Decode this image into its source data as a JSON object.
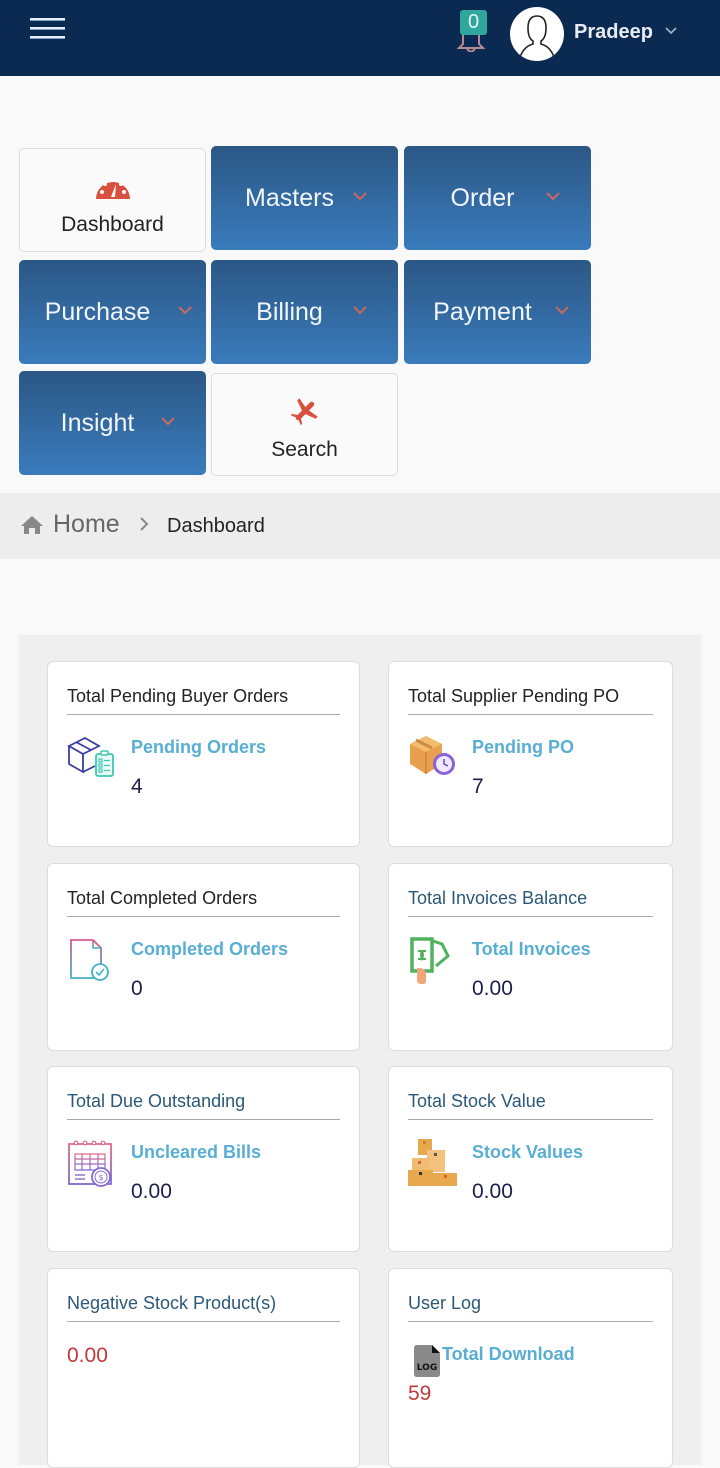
{
  "header": {
    "notification_count": "0",
    "user_name": "Pradeep"
  },
  "menu": {
    "dashboard": "Dashboard",
    "masters": "Masters",
    "order": "Order",
    "purchase": "Purchase",
    "billing": "Billing",
    "payment": "Payment",
    "insight": "Insight",
    "search": "Search"
  },
  "breadcrumb": {
    "home": "Home",
    "current": "Dashboard"
  },
  "cards": [
    {
      "title": "Total Pending Buyer Orders",
      "label": "Pending Orders",
      "value": "4"
    },
    {
      "title": "Total Supplier Pending PO",
      "label": "Pending PO",
      "value": "7"
    },
    {
      "title": "Total Completed Orders",
      "label": "Completed Orders",
      "value": "0"
    },
    {
      "title": "Total Invoices Balance",
      "label": "Total Invoices",
      "value": "0.00"
    },
    {
      "title": "Total Due Outstanding",
      "label": "Uncleared Bills",
      "value": "0.00"
    },
    {
      "title": "Total Stock Value",
      "label": "Stock Values",
      "value": "0.00"
    },
    {
      "title": "Negative Stock Product(s)",
      "value": "0.00"
    },
    {
      "title": "User Log",
      "label": "Total Download",
      "value": "59"
    }
  ],
  "colors": {
    "header_bg": "#0b2a52",
    "menu_blue_top": "#2b5785",
    "menu_blue_bottom": "#3a7bbc",
    "accent_red": "#d9503f",
    "link_blue": "#58aed3",
    "value_red": "#c0393b",
    "badge_teal": "#2fa79d"
  }
}
